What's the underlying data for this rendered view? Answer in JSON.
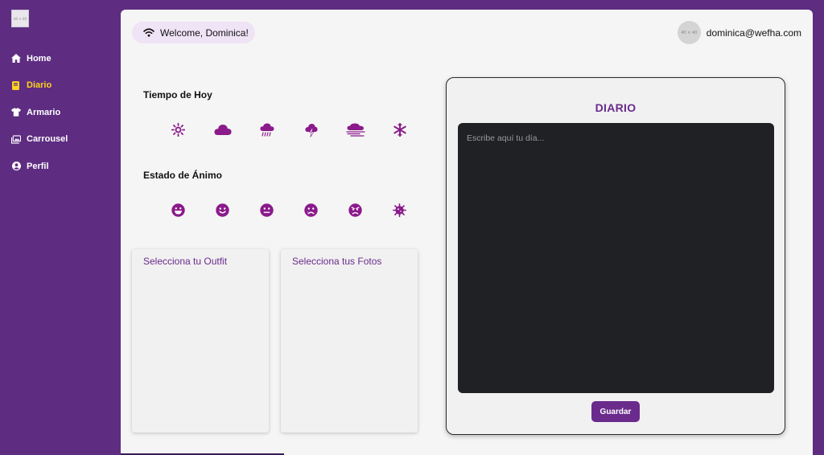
{
  "logo": {
    "text": "40 × 40"
  },
  "sidebar": {
    "items": [
      {
        "label": "Home",
        "icon": "home-icon"
      },
      {
        "label": "Diario",
        "icon": "book-icon",
        "active": true
      },
      {
        "label": "Armario",
        "icon": "shirt-icon"
      },
      {
        "label": "Carrousel",
        "icon": "images-icon"
      },
      {
        "label": "Perfil",
        "icon": "user-circle-icon"
      }
    ]
  },
  "header": {
    "welcome": "Welcome, Dominica!",
    "avatar_text": "40 × 40",
    "email": "dominica@wefha.com"
  },
  "weather": {
    "title": "Tiempo de Hoy",
    "icons": [
      "sun-icon",
      "cloud-icon",
      "rain-icon",
      "storm-icon",
      "fog-icon",
      "snowflake-icon"
    ]
  },
  "mood": {
    "title": "Estado de Ánimo",
    "icons": [
      "laugh-icon",
      "smile-icon",
      "neutral-icon",
      "sad-icon",
      "angry-icon",
      "virus-icon"
    ]
  },
  "cards": {
    "outfit": "Selecciona tu Outfit",
    "photos": "Selecciona tus Fotos"
  },
  "diary": {
    "title": "DIARIO",
    "placeholder": "Escribe aquí tu día...",
    "value": "",
    "save_label": "Guardar"
  },
  "colors": {
    "purple": "#5e2d82",
    "accent": "#6a2b8c",
    "active_nav": "#ffd21f",
    "icon": "#8b1a8b"
  }
}
